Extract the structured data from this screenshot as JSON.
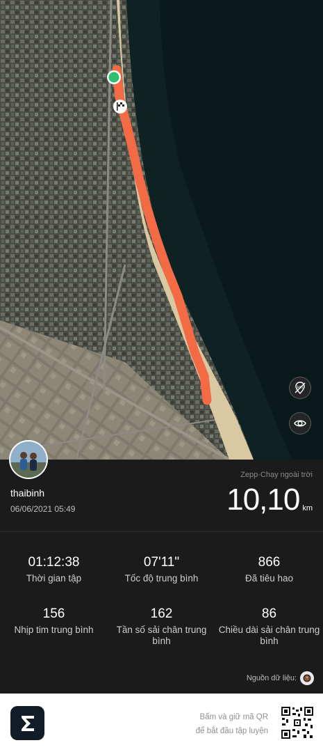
{
  "map": {
    "route_color": "#f26b45",
    "start_marker": "start-point-icon",
    "finish_marker": "finish-flag-icon",
    "buttons": {
      "km_toggle_icon": "km-marker-icon",
      "visibility_icon": "eye-icon"
    }
  },
  "summary": {
    "username": "thaibinh",
    "datetime": "06/06/2021 05:49",
    "activity": "Zepp·Chạy ngoài trời",
    "distance_value": "10,10",
    "distance_unit": "km"
  },
  "stats": [
    {
      "value": "01:12:38",
      "label": "Thời gian tập"
    },
    {
      "value": "07'11\"",
      "label": "Tốc độ trung bình"
    },
    {
      "value": "866",
      "label": "Đã tiêu hao"
    },
    {
      "value": "156",
      "label": "Nhịp tim trung bình"
    },
    {
      "value": "162",
      "label": "Tần số sải chân trung bình"
    },
    {
      "value": "86",
      "label": "Chiều dài sải chân trung bình"
    }
  ],
  "source": {
    "label": "Nguồn dữ liệu:",
    "icon": "watch-icon"
  },
  "footer": {
    "qr_line1": "Bấm và giữ mã QR",
    "qr_line2": "để bắt đầu tập luyện",
    "logo_icon": "zepp-logo-icon",
    "qr_icon": "qr-code-icon"
  },
  "colors": {
    "background": "#1b1b1b",
    "route": "#f26b45",
    "start": "#2fbf71"
  }
}
